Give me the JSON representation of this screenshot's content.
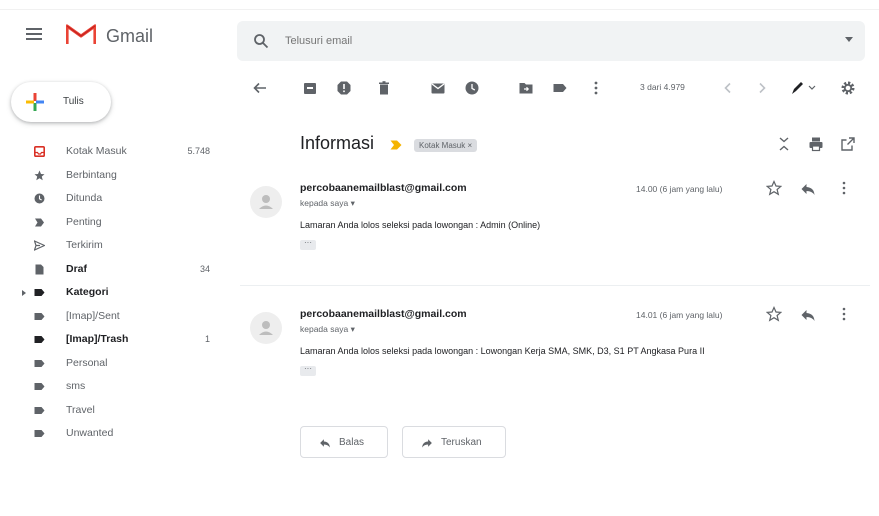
{
  "app": {
    "brand": "Gmail"
  },
  "search": {
    "placeholder": "Telusuri email"
  },
  "compose": {
    "label": "Tulis"
  },
  "nav": [
    {
      "label": "Kotak Masuk",
      "count": "5.748",
      "icon": "inbox-icon",
      "state": "active"
    },
    {
      "label": "Berbintang",
      "count": "",
      "icon": "star-icon",
      "state": ""
    },
    {
      "label": "Ditunda",
      "count": "",
      "icon": "clock-icon",
      "state": ""
    },
    {
      "label": "Penting",
      "count": "",
      "icon": "important-icon",
      "state": ""
    },
    {
      "label": "Terkirim",
      "count": "",
      "icon": "send-icon",
      "state": ""
    },
    {
      "label": "Draf",
      "count": "34",
      "icon": "draft-icon",
      "state": "bold"
    },
    {
      "label": "Kategori",
      "count": "",
      "icon": "label-icon",
      "state": "bold"
    },
    {
      "label": "[Imap]/Sent",
      "count": "",
      "icon": "label-icon",
      "state": ""
    },
    {
      "label": "[Imap]/Trash",
      "count": "1",
      "icon": "label-icon",
      "state": "bold"
    },
    {
      "label": "Personal",
      "count": "",
      "icon": "label-icon",
      "state": ""
    },
    {
      "label": "sms",
      "count": "",
      "icon": "label-icon",
      "state": ""
    },
    {
      "label": "Travel",
      "count": "",
      "icon": "label-icon",
      "state": ""
    },
    {
      "label": "Unwanted",
      "count": "",
      "icon": "label-icon",
      "state": ""
    }
  ],
  "toolbar": {
    "pager": "3 dari 4.979"
  },
  "thread": {
    "subject": "Informasi",
    "label_chip": "Kotak Masuk ×",
    "messages": [
      {
        "sender": "percobaanemailblast@gmail.com",
        "to": "kepada saya ▾",
        "time": "14.00 (6 jam yang lalu)",
        "body": "Lamaran Anda lolos seleksi pada lowongan : Admin (Online)",
        "dots": "···"
      },
      {
        "sender": "percobaanemailblast@gmail.com",
        "to": "kepada saya ▾",
        "time": "14.01 (6 jam yang lalu)",
        "body": "Lamaran Anda lolos seleksi pada lowongan : Lowongan Kerja SMA, SMK, D3, S1 PT Angkasa Pura II",
        "dots": "···"
      }
    ]
  },
  "actions": {
    "reply": "Balas",
    "forward": "Teruskan"
  },
  "colors": {
    "accent": "#d93025",
    "active_bg": "#fce8e6",
    "important": "#f4b400"
  }
}
